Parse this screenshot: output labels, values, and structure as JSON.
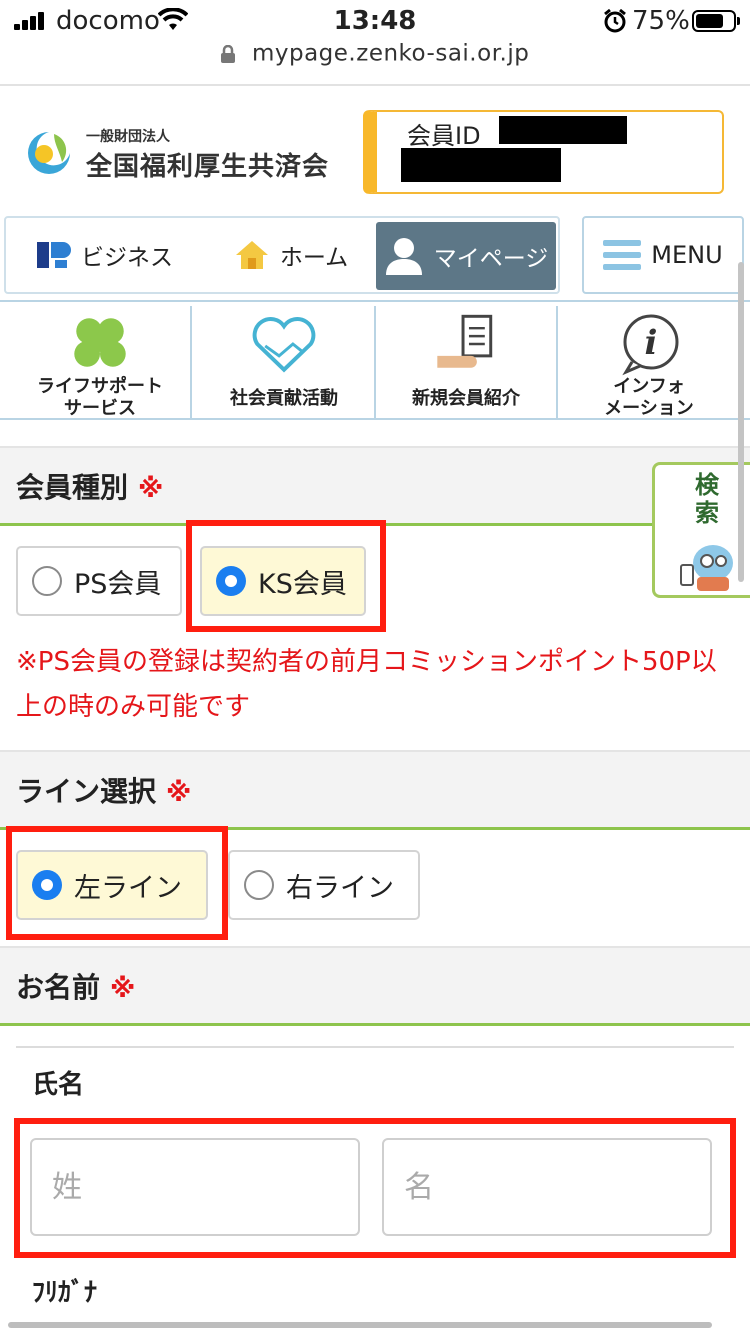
{
  "status_bar": {
    "carrier": "docomo",
    "time": "13:48",
    "battery": "75%",
    "battery_fraction": 0.75
  },
  "browser": {
    "url": "mypage.zenko-sai.or.jp"
  },
  "header": {
    "logo_sub": "一般財団法人",
    "logo_main": "全国福利厚生共済会",
    "member_label": "会員ID"
  },
  "nav": {
    "business": "ビジネス",
    "home": "ホーム",
    "mypage": "マイページ",
    "menu": "MENU"
  },
  "sub_nav": [
    {
      "label": "ライフサポート\nサービス",
      "icon": "clover-icon"
    },
    {
      "label": "社会貢献活動",
      "icon": "handshake-heart-icon"
    },
    {
      "label": "新規会員紹介",
      "icon": "document-hand-icon"
    },
    {
      "label": "インフォ\nメーション",
      "icon": "info-bubble-icon"
    }
  ],
  "form": {
    "member_type": {
      "title": "会員種別",
      "required_mark": "※",
      "options": [
        "PS会員",
        "KS会員"
      ],
      "selected": "KS会員",
      "notice": "※PS会員の登録は契約者の前月コミッションポイント50P以上の時のみ可能です"
    },
    "line": {
      "title": "ライン選択",
      "required_mark": "※",
      "options": [
        "左ライン",
        "右ライン"
      ],
      "selected": "左ライン"
    },
    "name": {
      "title": "お名前",
      "required_mark": "※",
      "full_name_label": "氏名",
      "last_name_placeholder": "姓",
      "first_name_placeholder": "名",
      "furigana_label": "ﾌﾘｶﾞﾅ"
    }
  },
  "float_search": {
    "label": "検索"
  },
  "colors": {
    "accent_green": "#8dc44c",
    "required_red": "#e5161a",
    "nav_active": "#5d7787",
    "radio_blue": "#1a7ef0",
    "highlight_frame": "#ff1e0f"
  }
}
